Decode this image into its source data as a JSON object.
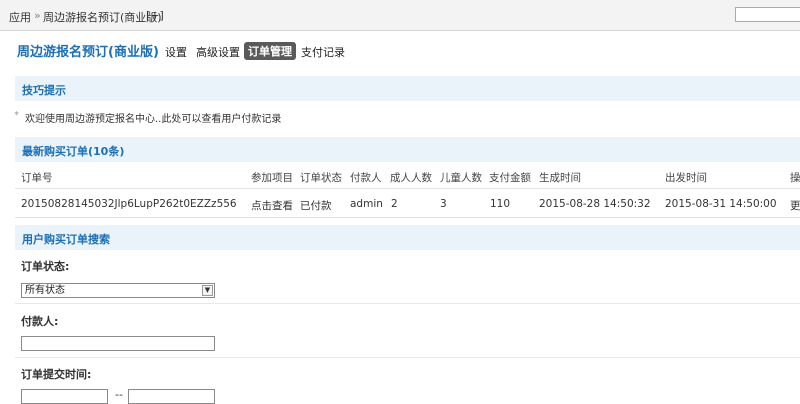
{
  "breadcrumb": {
    "root": "应用",
    "separator": "»",
    "current": "周边游报名预订(商业版)",
    "add": "[+]"
  },
  "plugin": {
    "title": "周边游报名预订(商业版)",
    "nav": [
      "设置",
      "高级设置",
      "订单管理",
      "支付记录"
    ],
    "active_tab": "订单管理"
  },
  "tips": {
    "title": "技巧提示",
    "bullet": "*",
    "text": "欢迎使用周边游预定报名中心..此处可以查看用户付款记录"
  },
  "orders": {
    "title": "最新购买订单(10条)",
    "columns": [
      "订单号",
      "参加项目",
      "订单状态",
      "付款人",
      "成人人数",
      "儿童人数",
      "支付金额",
      "生成时间",
      "出发时间",
      "操"
    ],
    "rows": [
      {
        "order_no": "20150828145032Jlp6LupP262t0EZZz556",
        "project": "点击查看",
        "status": "已付款",
        "payer": "admin",
        "adults": "2",
        "children": "3",
        "amount": "110",
        "created": "2015-08-28 14:50:32",
        "depart": "2015-08-31 14:50:00",
        "action": "更"
      }
    ]
  },
  "search": {
    "title": "用户购买订单搜索",
    "status_label": "订单状态:",
    "status_value": "所有状态",
    "payer_label": "付款人:",
    "time_label": "订单提交时间:",
    "range_sep": "--"
  },
  "colors": {
    "accent": "#1c6fb5",
    "section_bg": "#eaf3fa",
    "paid": "#d40000",
    "active_tab_bg": "#5a5a5a"
  }
}
